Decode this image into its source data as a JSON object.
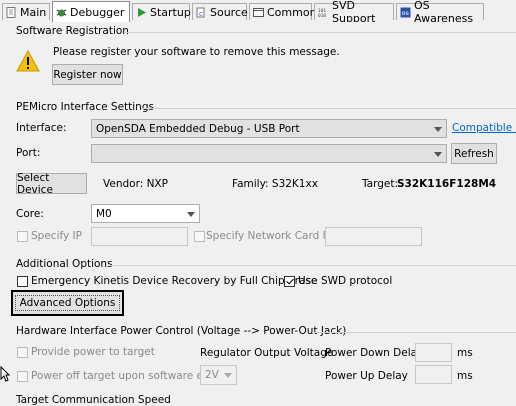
{
  "tabs": [
    {
      "label": "Main",
      "icon": "main-icon"
    },
    {
      "label": "Debugger",
      "icon": "debugger-icon"
    },
    {
      "label": "Startup",
      "icon": "startup-icon"
    },
    {
      "label": "Source",
      "icon": "source-icon"
    },
    {
      "label": "Common",
      "icon": "common-icon"
    },
    {
      "label": "SVD Support",
      "icon": "svd-icon"
    },
    {
      "label": "OS Awareness",
      "icon": "os-icon"
    }
  ],
  "registration": {
    "group_title": "Software Registration",
    "message": "Please register your software to remove this message.",
    "button": "Register now",
    "icon": "warning-icon"
  },
  "interface_settings": {
    "group_title": "PEMicro Interface Settings",
    "interface_label": "Interface:",
    "interface_value": "OpenSDA Embedded Debug - USB Port",
    "compatible_link": "Compatible H",
    "port_label": "Port:",
    "port_value": "",
    "refresh_button": "Refresh",
    "select_device_button": "Select Device",
    "vendor": "Vendor:  NXP",
    "family": "Family:  S32K1xx",
    "target_label": "Target:",
    "target_value": "S32K116F128M4",
    "core_label": "Core:",
    "core_value": "M0",
    "specify_ip": "Specify IP",
    "specify_network_card_ip": "Specify Network Card IP"
  },
  "additional": {
    "group_title": "Additional Options",
    "emergency_recovery": "Emergency Kinetis Device Recovery by Full Chip Erase",
    "use_swd": "Use SWD protocol",
    "use_swd_checked": true,
    "advanced_button": "Advanced Options"
  },
  "power": {
    "group_title": "Hardware Interface Power Control (Voltage --> Power-Out Jack)",
    "provide_power": "Provide power to target",
    "power_off": "Power off target upon software exit",
    "regulator_label": "Regulator Output Voltage",
    "voltage_value": "2V",
    "power_down_label": "Power Down Delay",
    "power_up_label": "Power Up Delay",
    "ms1": "ms",
    "ms2": "ms"
  },
  "bottom_group_title": "Target Communication Speed"
}
